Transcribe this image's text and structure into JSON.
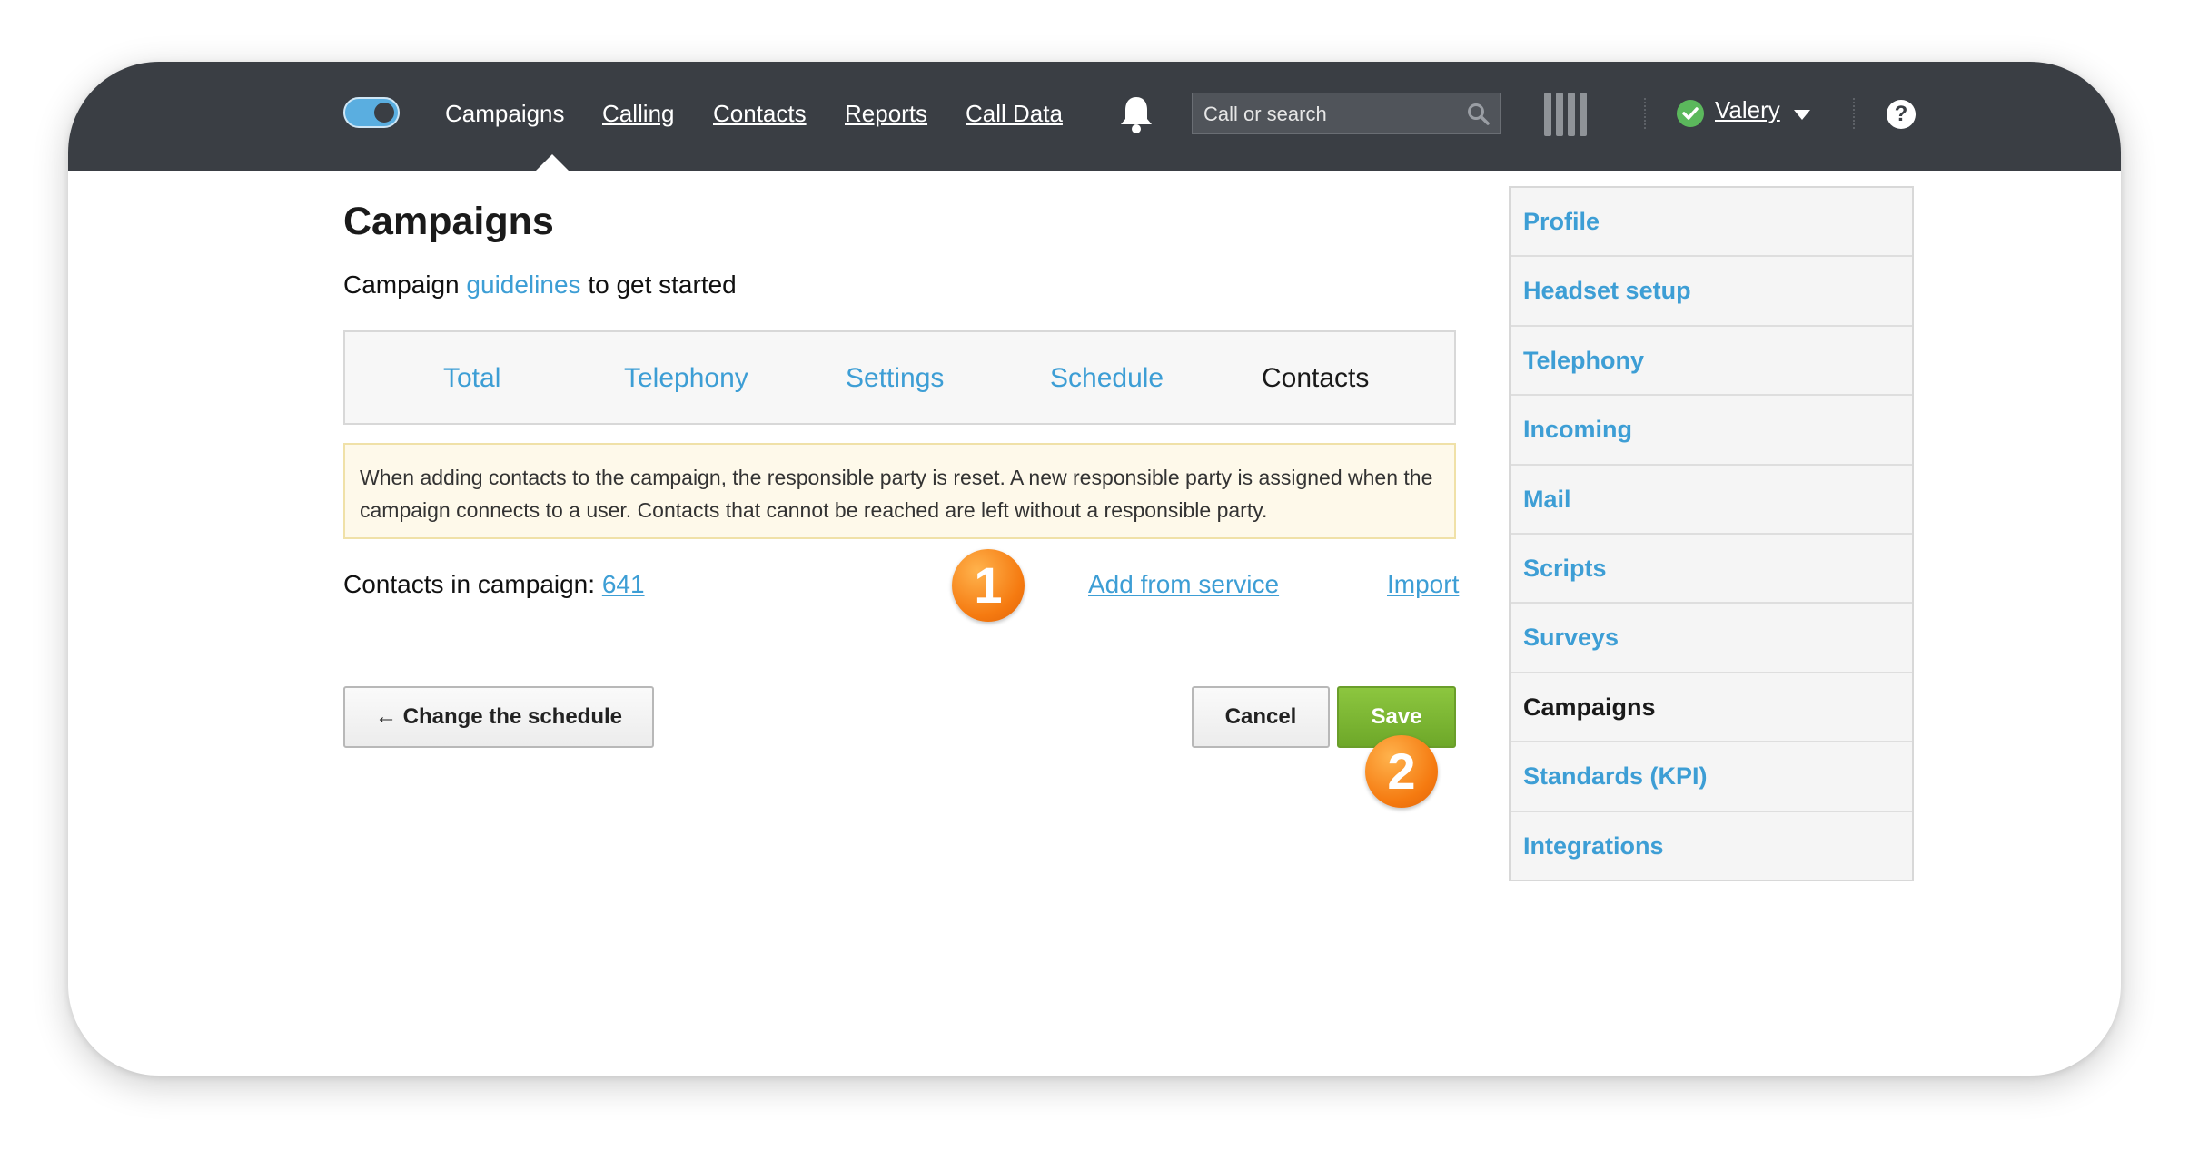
{
  "nav": {
    "items": [
      {
        "label": "Campaigns"
      },
      {
        "label": "Calling"
      },
      {
        "label": "Contacts"
      },
      {
        "label": "Reports"
      },
      {
        "label": "Call Data"
      }
    ],
    "search_placeholder": "Call or search",
    "user_name": "Valery",
    "help_label": "?"
  },
  "page": {
    "title": "Campaigns",
    "intro_prefix": "Campaign",
    "intro_link": "guidelines",
    "intro_suffix": "to get started"
  },
  "tabs": [
    {
      "label": "Total"
    },
    {
      "label": "Telephony"
    },
    {
      "label": "Settings"
    },
    {
      "label": "Schedule"
    },
    {
      "label": "Contacts",
      "active": true
    }
  ],
  "notice": "When adding contacts to the campaign, the responsible party is reset. A new responsible party is assigned when the campaign connects to a user. Contacts that cannot be reached are left without a responsible party.",
  "contacts": {
    "label": "Contacts in campaign:",
    "count": "641",
    "add_from_service": "Add from service",
    "import": "Import"
  },
  "buttons": {
    "back": "← Change the schedule",
    "cancel": "Cancel",
    "save": "Save"
  },
  "badges": [
    "1",
    "2"
  ],
  "sidebar": {
    "items": [
      {
        "label": "Profile"
      },
      {
        "label": "Headset setup"
      },
      {
        "label": "Telephony"
      },
      {
        "label": "Incoming"
      },
      {
        "label": "Mail"
      },
      {
        "label": "Scripts"
      },
      {
        "label": "Surveys"
      },
      {
        "label": "Campaigns",
        "active": true
      },
      {
        "label": "Standards (KPI)"
      },
      {
        "label": "Integrations"
      }
    ]
  },
  "colors": {
    "topbar": "#3a3e44",
    "link": "#3d9ed5",
    "save": "#7cb832",
    "badge": "#f57a10",
    "notice_bg": "#fef9ea"
  }
}
